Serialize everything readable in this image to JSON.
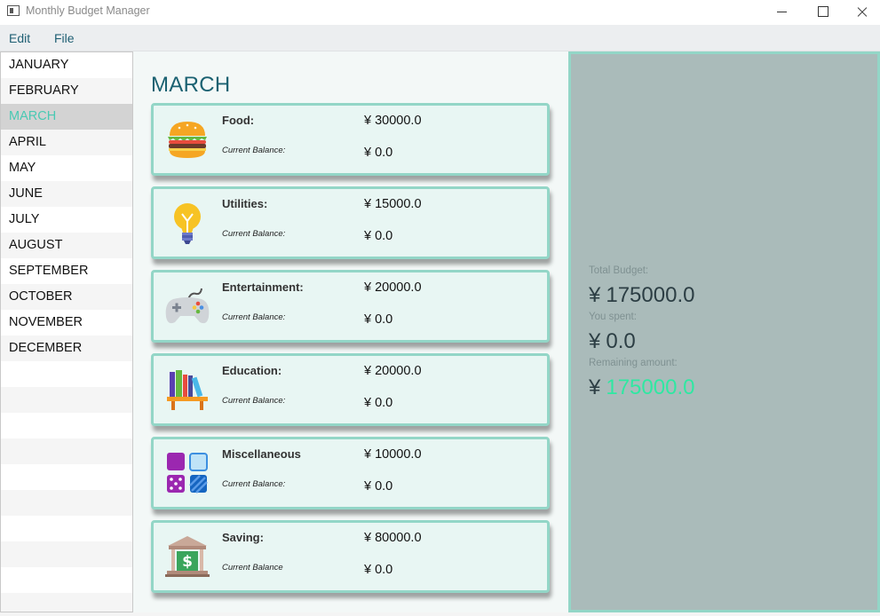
{
  "window": {
    "title": "Monthly Budget Manager"
  },
  "menu": {
    "edit": "Edit",
    "file": "File"
  },
  "months": [
    "JANUARY",
    "FEBRUARY",
    "MARCH",
    "APRIL",
    "MAY",
    "JUNE",
    "JULY",
    "AUGUST",
    "SEPTEMBER",
    "OCTOBER",
    "NOVEMBER",
    "DECEMBER"
  ],
  "selected_month": "MARCH",
  "main": {
    "title": "MARCH",
    "categories": [
      {
        "name": "Food:",
        "amount": "¥ 30000.0",
        "balance_label": "Current Balance:",
        "balance": "¥ 0.0",
        "icon": "burger-icon"
      },
      {
        "name": "Utilities:",
        "amount": "¥ 15000.0",
        "balance_label": "Current Balance:",
        "balance": "¥ 0.0",
        "icon": "lightbulb-icon"
      },
      {
        "name": "Entertainment:",
        "amount": "¥ 20000.0",
        "balance_label": "Current Balance:",
        "balance": "¥ 0.0",
        "icon": "gamepad-icon"
      },
      {
        "name": "Education:",
        "amount": "¥ 20000.0",
        "balance_label": "Current Balance:",
        "balance": "¥ 0.0",
        "icon": "books-icon"
      },
      {
        "name": "Miscellaneous",
        "amount": "¥ 10000.0",
        "balance_label": "Current Balance:",
        "balance": "¥ 0.0",
        "icon": "misc-shapes-icon"
      },
      {
        "name": "Saving:",
        "amount": "¥ 80000.0",
        "balance_label": "Current Balance",
        "balance": "¥ 0.0",
        "icon": "bank-icon"
      }
    ]
  },
  "summary": {
    "total_label": "Total Budget:",
    "currency": "¥",
    "total": "175000.0",
    "spent_label": "You spent:",
    "spent": "0.0",
    "remaining_label": "Remaining amount:",
    "remaining": "175000.0"
  },
  "colors": {
    "accent": "#49c9b3",
    "card_border": "#93d6c7",
    "title": "#1a6171",
    "remaining": "#2fe8a2"
  }
}
